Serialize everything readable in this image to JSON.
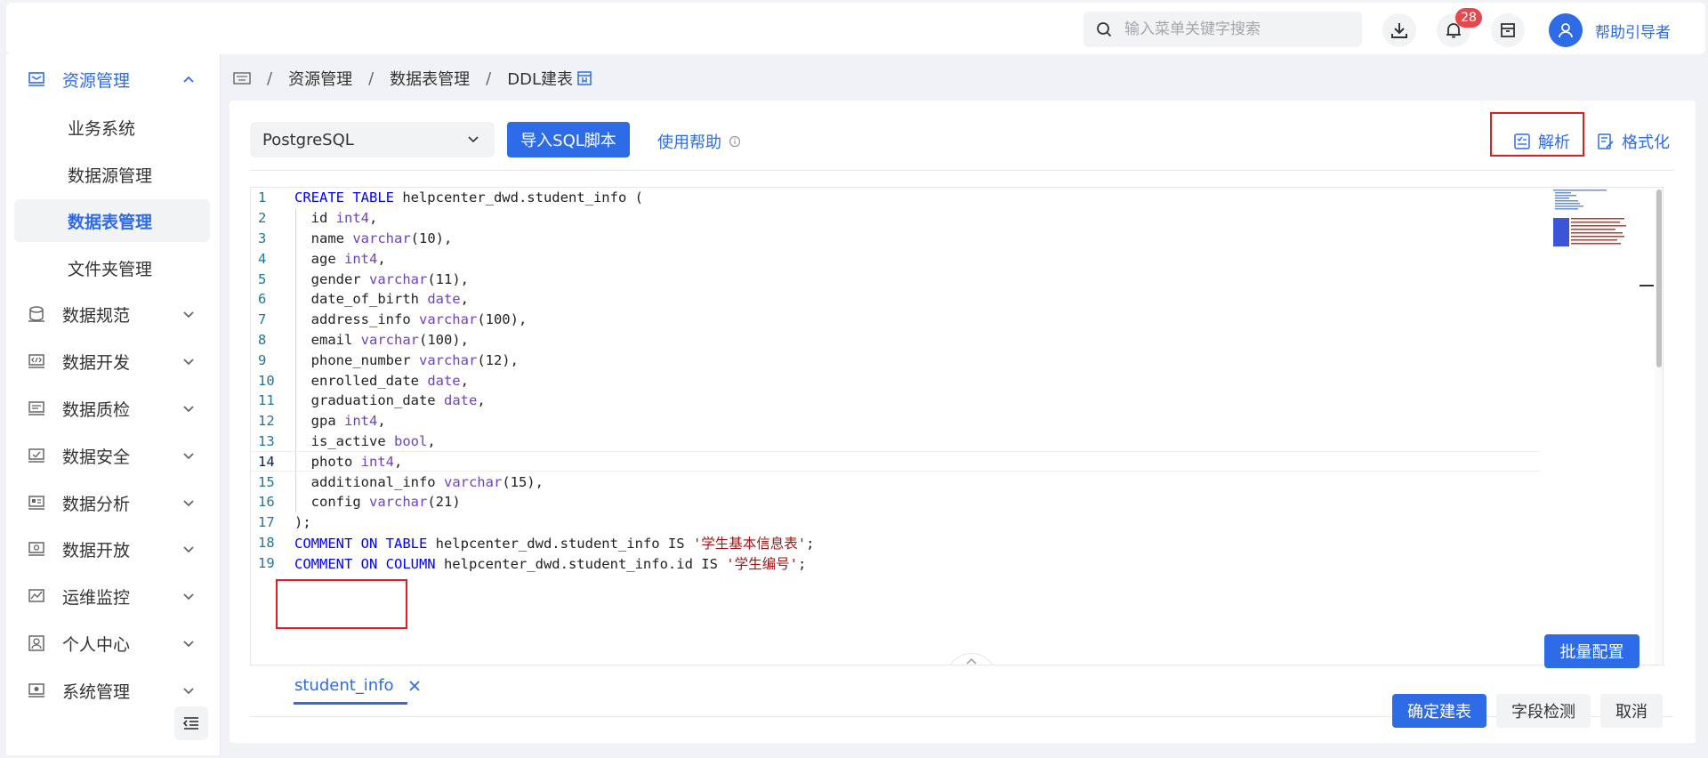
{
  "header": {
    "search_placeholder": "输入菜单关键字搜索",
    "notification_count": "28",
    "username": "帮助引导者"
  },
  "breadcrumb": [
    "资源管理",
    "数据表管理",
    "DDL建表"
  ],
  "sidebar": {
    "top_section": "资源管理",
    "sub_items": [
      "业务系统",
      "数据源管理",
      "数据表管理",
      "文件夹管理"
    ],
    "active_sub": "数据表管理",
    "sections": [
      "数据规范",
      "数据开发",
      "数据质检",
      "数据安全",
      "数据分析",
      "数据开放",
      "运维监控",
      "个人中心",
      "系统管理"
    ]
  },
  "toolbar": {
    "db_type": "PostgreSQL",
    "import_label": "导入SQL脚本",
    "help_label": "使用帮助",
    "parse_label": "解析",
    "format_label": "格式化"
  },
  "editor": {
    "current_line": 14,
    "lines": [
      "1",
      "2",
      "3",
      "4",
      "5",
      "6",
      "7",
      "8",
      "9",
      "10",
      "11",
      "12",
      "13",
      "14",
      "15",
      "16",
      "17",
      "18",
      "19"
    ],
    "code": {
      "l1_kw": "CREATE TABLE",
      "l1_rest": " helpcenter_dwd.student_info (",
      "l2_name": "  id ",
      "l2_type": "int4",
      "l2_end": ",",
      "l3_name": "  name ",
      "l3_type": "varchar",
      "l3_end": "(10),",
      "l4_name": "  age ",
      "l4_type": "int4",
      "l4_end": ",",
      "l5_name": "  gender ",
      "l5_type": "varchar",
      "l5_end": "(11),",
      "l6_name": "  date_of_birth ",
      "l6_type": "date",
      "l6_end": ",",
      "l7_name": "  address_info ",
      "l7_type": "varchar",
      "l7_end": "(100),",
      "l8_name": "  email ",
      "l8_type": "varchar",
      "l8_end": "(100),",
      "l9_name": "  phone_number ",
      "l9_type": "varchar",
      "l9_end": "(12),",
      "l10_name": "  enrolled_date ",
      "l10_type": "date",
      "l10_end": ",",
      "l11_name": "  graduation_date ",
      "l11_type": "date",
      "l11_end": ",",
      "l12_name": "  gpa ",
      "l12_type": "int4",
      "l12_end": ",",
      "l13_name": "  is_active ",
      "l13_type": "bool",
      "l13_end": ",",
      "l14_name": "  photo ",
      "l14_type": "int4",
      "l14_end": ",",
      "l15_name": "  additional_info ",
      "l15_type": "varchar",
      "l15_end": "(15),",
      "l16_name": "  config ",
      "l16_type": "varchar",
      "l16_end": "(21)",
      "l17": ");",
      "l18_kw": "COMMENT ON TABLE",
      "l18_mid": " helpcenter_dwd.student_info IS ",
      "l18_str": "'学生基本信息表'",
      "l18_end": ";",
      "l19_kw": "COMMENT ON COLUMN",
      "l19_mid": " helpcenter_dwd.student_info.id IS ",
      "l19_str": "'学生编号'",
      "l19_end": ";"
    }
  },
  "tabs": {
    "active": "student_info"
  },
  "buttons": {
    "batch_config": "批量配置",
    "confirm": "确定建表",
    "field_check": "字段检测",
    "cancel": "取消"
  },
  "colors": {
    "primary": "#2e6be6",
    "highlight_box": "#e02020",
    "badge": "#e5484d"
  }
}
